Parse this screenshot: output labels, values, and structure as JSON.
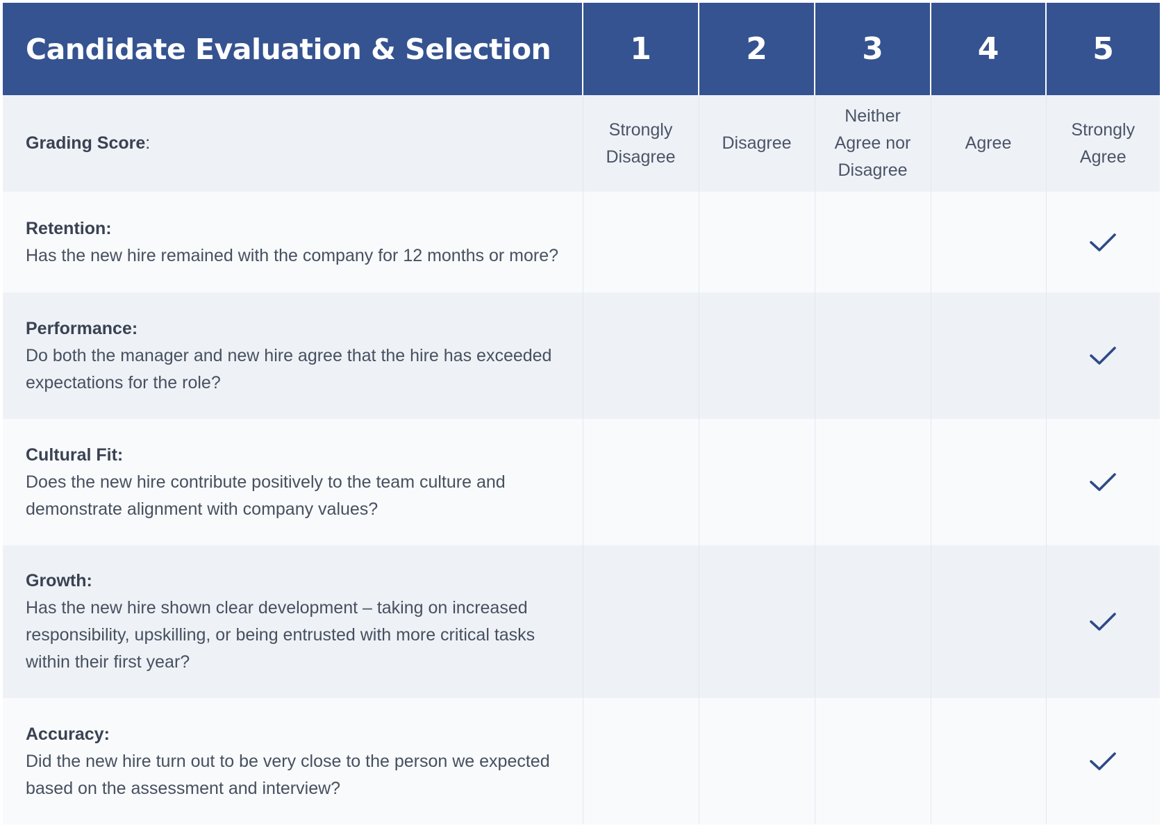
{
  "header": {
    "title": "Candidate Evaluation & Selection",
    "scores": [
      "1",
      "2",
      "3",
      "4",
      "5"
    ]
  },
  "grading": {
    "label": "Grading Score",
    "colon": ":",
    "scale": [
      {
        "line1": "Strongly",
        "line2": "Disagree",
        "line3": ""
      },
      {
        "line1": "Disagree",
        "line2": "",
        "line3": ""
      },
      {
        "line1": "Neither",
        "line2": "Agree nor",
        "line3": "Disagree"
      },
      {
        "line1": "Agree",
        "line2": "",
        "line3": ""
      },
      {
        "line1": "Strongly",
        "line2": "Agree",
        "line3": ""
      }
    ]
  },
  "criteria": [
    {
      "title": "Retention:",
      "question": "Has the new hire remained with the company for 12 months or more?",
      "score": 5
    },
    {
      "title": "Performance:",
      "question": "Do both the manager and new hire agree that the hire has exceeded expectations for the role?",
      "score": 5
    },
    {
      "title": "Cultural Fit:",
      "question": "Does the new hire contribute positively to the team culture and demonstrate alignment with company values?",
      "score": 5
    },
    {
      "title": "Growth:",
      "question": "Has the new hire shown clear development – taking on increased responsibility, upskilling, or being entrusted with more critical tasks within their first year?",
      "score": 5
    },
    {
      "title": "Accuracy:",
      "question": "Did the new hire turn out to be very close to the person we expected based on the assessment and interview?",
      "score": 5
    }
  ],
  "icons": {
    "check": "check-icon"
  },
  "colors": {
    "header_bg": "#355390",
    "check": "#2f4a86",
    "row_alt": "#eef2f7",
    "row_light": "#f8fafc"
  }
}
